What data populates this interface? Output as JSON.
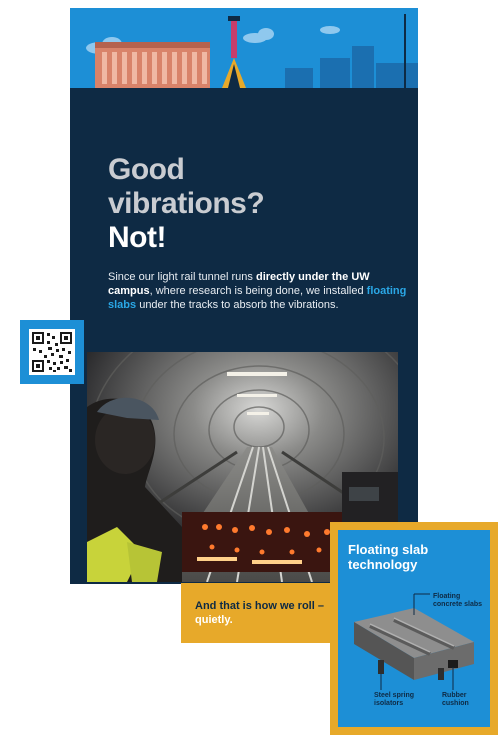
{
  "headline": {
    "line1": "Good",
    "line2": "vibrations?",
    "line3": "Not!"
  },
  "intro": {
    "part1": "Since our light rail tunnel runs ",
    "bold1": "directly under the UW campus",
    "part2": ", where research is being done, we installed ",
    "highlight": "floating slabs",
    "part3": " under the tracks to absorb the vibrations."
  },
  "callout": {
    "text": "And that is how we roll – ",
    "highlight": "quietly."
  },
  "tech_card": {
    "title": "Floating slab technology",
    "labels": {
      "floating_concrete_slabs": "Floating concrete slabs",
      "rubber_cushion": "Rubber cushion",
      "steel_spring_isolators": "Steel spring isolators"
    }
  },
  "colors": {
    "navy": "#0e2a44",
    "blue": "#1d8fd6",
    "gold": "#e7a92a",
    "accent_text": "#2aa7e6"
  },
  "icons": {
    "qr": "qr-code-icon",
    "building": "building-illustration",
    "tower": "space-needle-illustration"
  }
}
